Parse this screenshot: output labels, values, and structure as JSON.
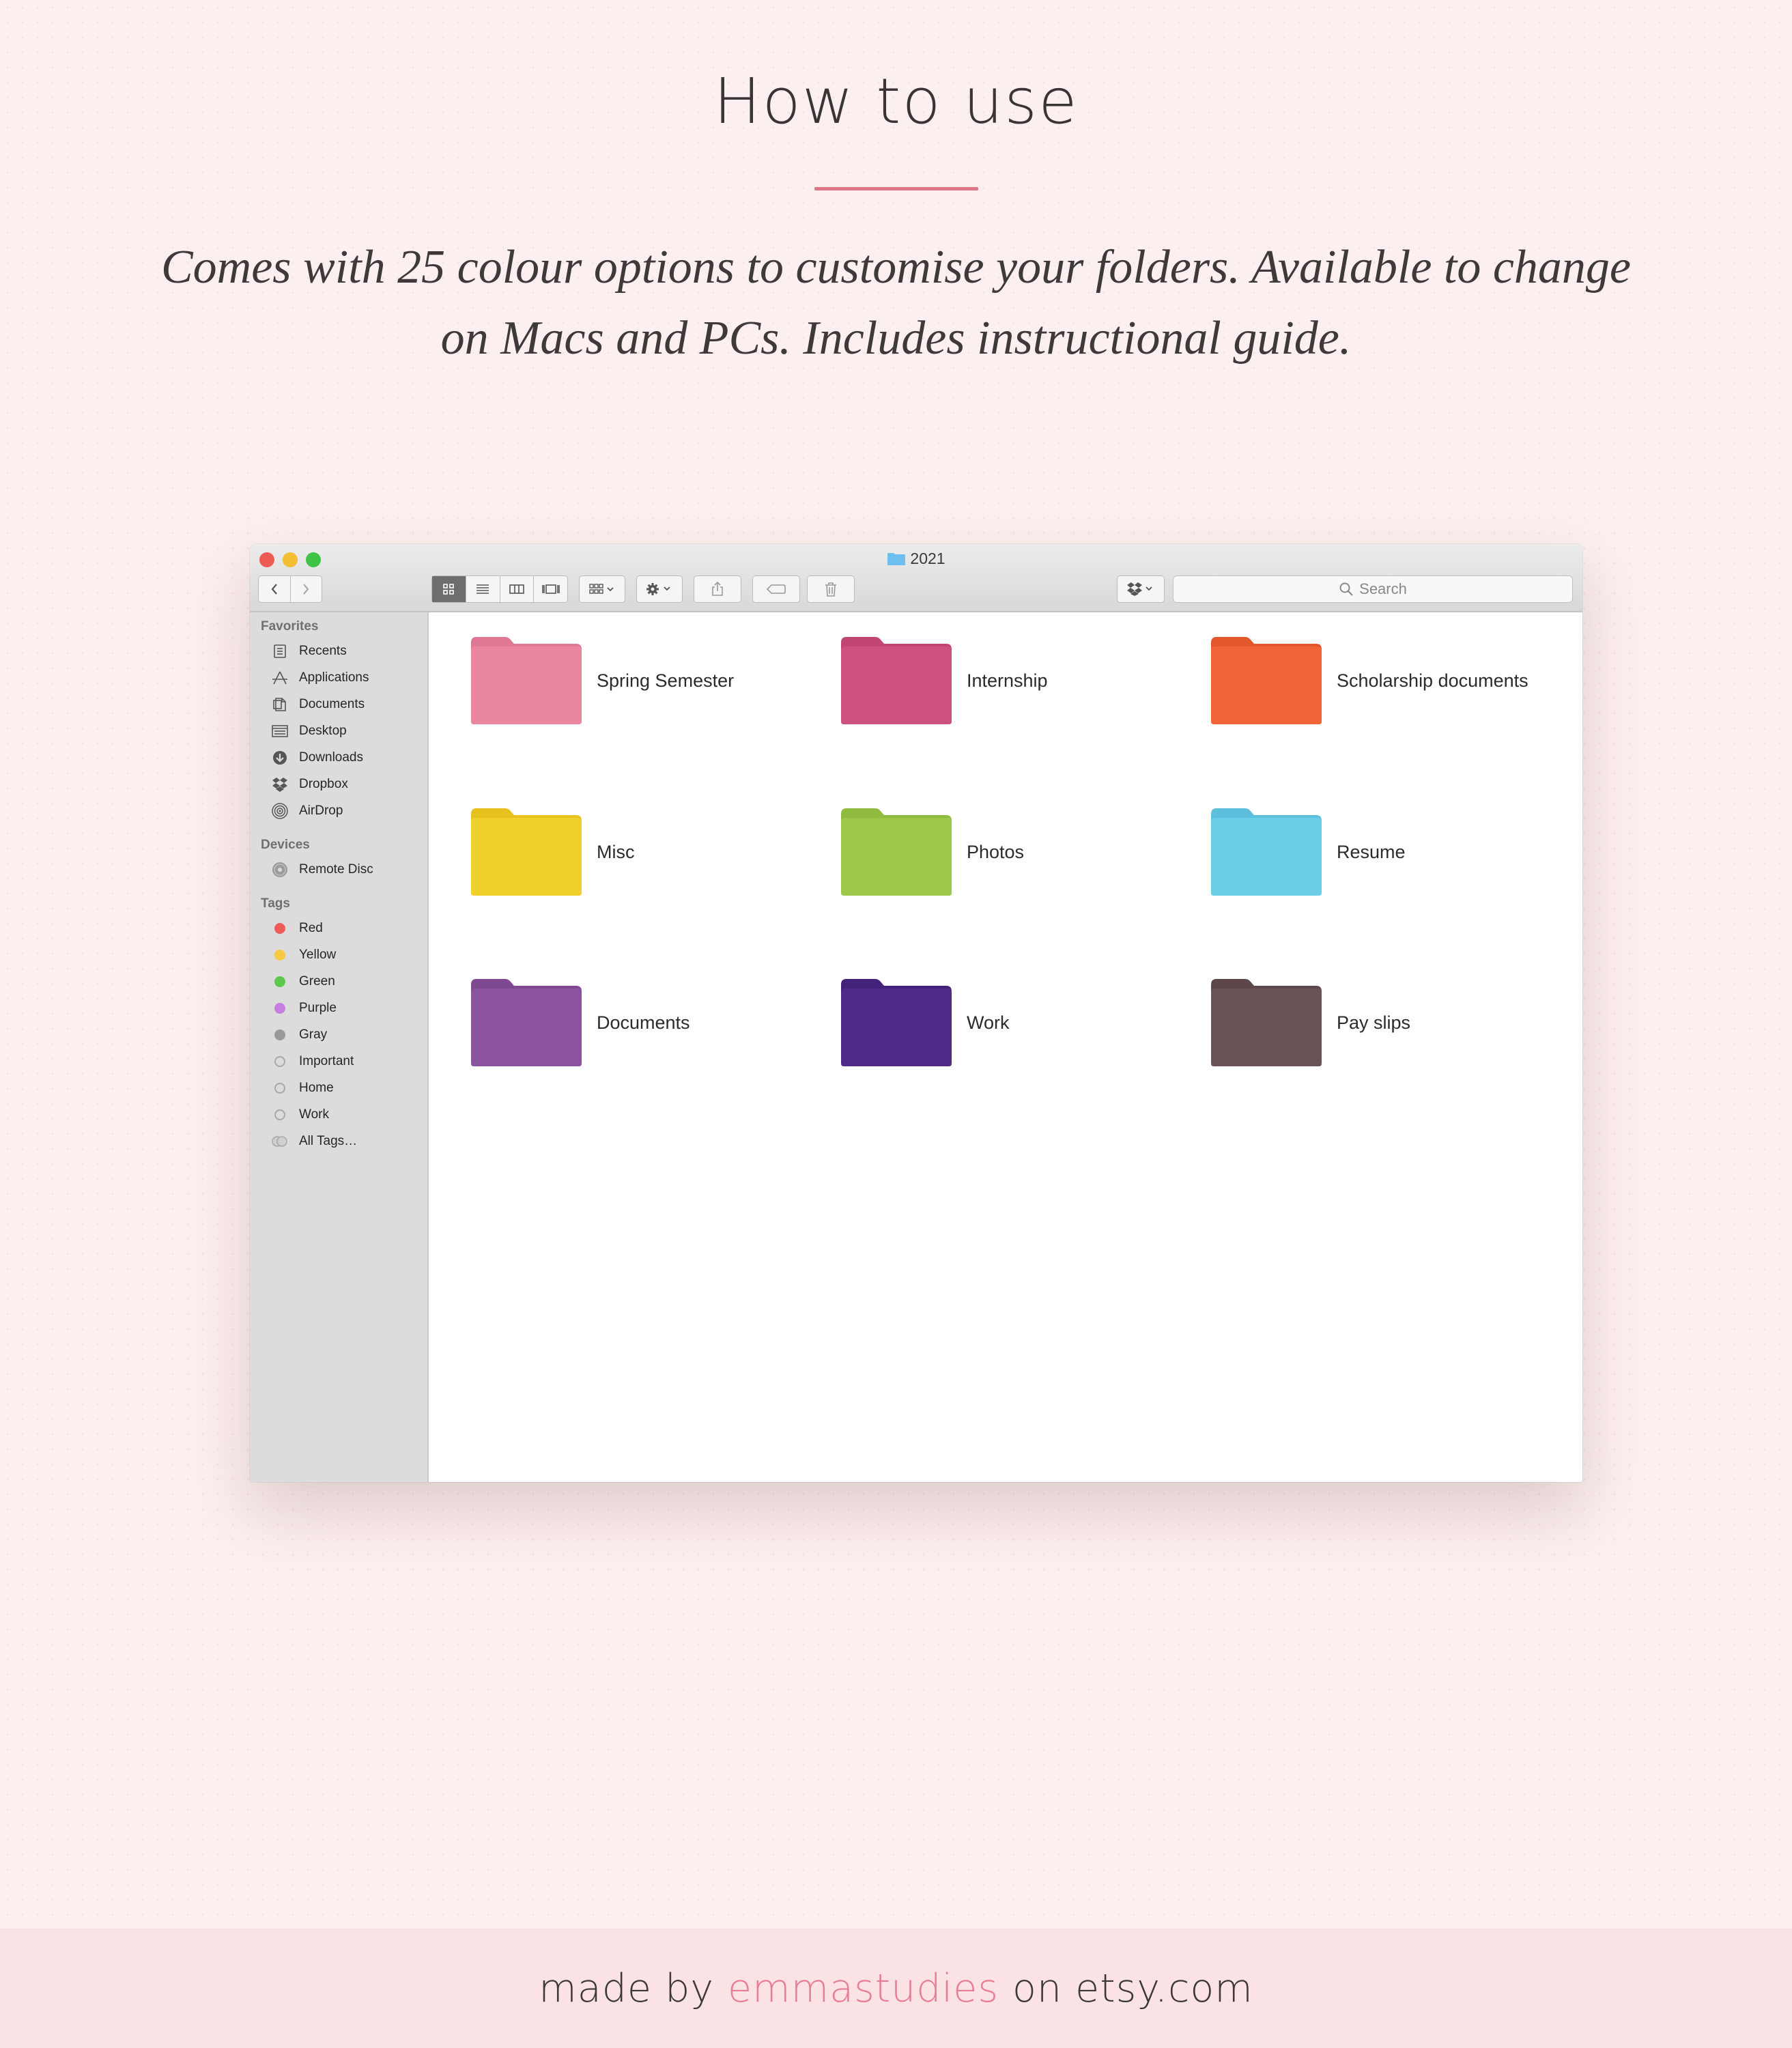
{
  "header": {
    "title": "How to use",
    "subtitle": "Comes with 25 colour options to customise your folders. Available to change on Macs and PCs. Includes instructional guide."
  },
  "window": {
    "title": "2021",
    "search_placeholder": "Search"
  },
  "sidebar": {
    "favorites_heading": "Favorites",
    "favorites": [
      {
        "label": "Recents",
        "icon": "recents-icon"
      },
      {
        "label": "Applications",
        "icon": "applications-icon"
      },
      {
        "label": "Documents",
        "icon": "documents-icon"
      },
      {
        "label": "Desktop",
        "icon": "desktop-icon"
      },
      {
        "label": "Downloads",
        "icon": "downloads-icon"
      },
      {
        "label": "Dropbox",
        "icon": "dropbox-icon"
      },
      {
        "label": "AirDrop",
        "icon": "airdrop-icon"
      }
    ],
    "devices_heading": "Devices",
    "devices": [
      {
        "label": "Remote Disc",
        "icon": "disc-icon"
      }
    ],
    "tags_heading": "Tags",
    "tags": [
      {
        "label": "Red",
        "color": "#ef5b5b"
      },
      {
        "label": "Yellow",
        "color": "#f7c843"
      },
      {
        "label": "Green",
        "color": "#5cc94d"
      },
      {
        "label": "Purple",
        "color": "#c77ee0"
      },
      {
        "label": "Gray",
        "color": "#9a9a9a"
      },
      {
        "label": "Important",
        "color": "none"
      },
      {
        "label": "Home",
        "color": "none"
      },
      {
        "label": "Work",
        "color": "none"
      },
      {
        "label": "All Tags…",
        "color": "all"
      }
    ]
  },
  "folders": [
    {
      "name": "Spring Semester",
      "color": "#ea879f",
      "tab": "#e07793"
    },
    {
      "name": "Internship",
      "color": "#cd517e",
      "tab": "#c14573"
    },
    {
      "name": "Scholarship documents",
      "color": "#f26437",
      "tab": "#e3572c"
    },
    {
      "name": "Misc",
      "color": "#f1d02e",
      "tab": "#e7c21f"
    },
    {
      "name": "Photos",
      "color": "#9cc84a",
      "tab": "#8fbb3e"
    },
    {
      "name": "Resume",
      "color": "#6ccde8",
      "tab": "#5dbfdc"
    },
    {
      "name": "Documents",
      "color": "#8b539f",
      "tab": "#7e4892"
    },
    {
      "name": "Work",
      "color": "#4f2b87",
      "tab": "#44227b"
    },
    {
      "name": "Pay slips",
      "color": "#6b5355",
      "tab": "#5e474a"
    }
  ],
  "footer": {
    "prefix": "made by",
    "brand": "emmastudies",
    "suffix": "on etsy.com"
  }
}
